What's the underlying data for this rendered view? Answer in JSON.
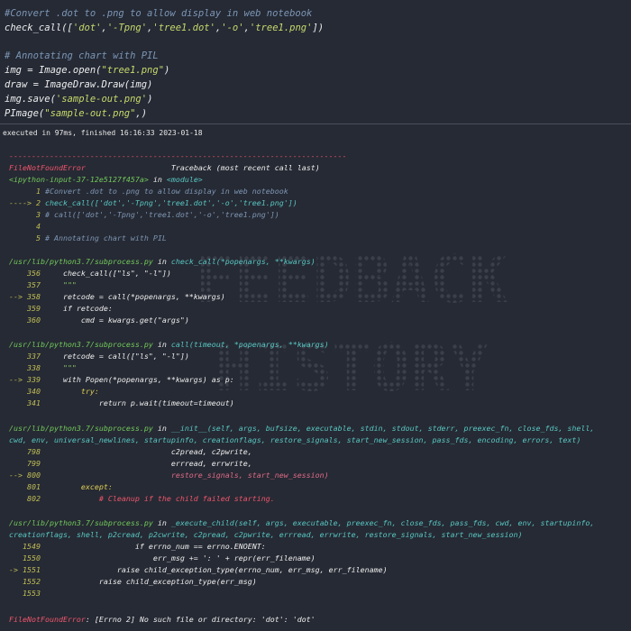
{
  "code_cell": {
    "comment1": "#Convert .dot to .png to allow display in web notebook",
    "call_line": {
      "fn": "check_call",
      "open": "([",
      "args": [
        "'dot'",
        "'-Tpng'",
        "'tree1.dot'",
        "'-o'",
        "'tree1.png'"
      ],
      "close": "])",
      "sep": ","
    },
    "comment2": "# Annotating chart with PIL",
    "img_line": {
      "var": "img",
      "op": " = ",
      "call": "Image.open(",
      "str": "\"tree1.png\"",
      "end": ")"
    },
    "draw_line": {
      "var": "draw",
      "op": " = ",
      "call": "ImageDraw.Draw(img)"
    },
    "save_line": {
      "call": "img.save(",
      "str": "'sample-out.png'",
      "end": ")"
    },
    "pimage_line": {
      "call": "PImage(",
      "str": "\"sample-out.png\"",
      "end": ",)"
    }
  },
  "status": "executed in 97ms, finished 16:16:33 2023-01-18",
  "traceback": {
    "dashes": "---------------------------------------------------------------------------",
    "error_name": "FileNotFoundError",
    "header_right": "Traceback (most recent call last)",
    "ipy_input": "<ipython-input-37-12e5127f457a>",
    "in_word": " in ",
    "module": "<module>",
    "frame1": [
      {
        "num": "      1",
        "body": " #Convert .dot to .png to allow display in web notebook",
        "cls": "c-comment"
      },
      {
        "num": "----> 2",
        "body": " check_call(['dot','-Tpng','tree1.dot','-o','tree1.png'])",
        "cls": "c-teal"
      },
      {
        "num": "      3",
        "body": " # call(['dot','-Tpng','tree1.dot','-o','tree1.png'])",
        "cls": "c-comment"
      },
      {
        "num": "      4",
        "body": "",
        "cls": "c-white"
      },
      {
        "num": "      5",
        "body": " # Annotating chart with PIL",
        "cls": "c-comment"
      }
    ],
    "sections": [
      {
        "file": "/usr/lib/python3.7/subprocess.py",
        "fn": "check_call",
        "sig": "(*popenargs, **kwargs)",
        "sig2": "",
        "lines": [
          {
            "num": "    356",
            "body": "     check_call([\"ls\", \"-l\"])",
            "cls": "c-white"
          },
          {
            "num": "    357",
            "body": "     \"\"\"",
            "cls": "c-strg"
          },
          {
            "num": "--> 358",
            "body": "     retcode = call(*popenargs, **kwargs)",
            "cls": "c-white"
          },
          {
            "num": "    359",
            "body": "     if retcode:",
            "cls": "c-white"
          },
          {
            "num": "    360",
            "body": "         cmd = kwargs.get(\"args\")",
            "cls": "c-white"
          }
        ]
      },
      {
        "file": "/usr/lib/python3.7/subprocess.py",
        "fn": "call",
        "sig": "(timeout, *popenargs, **kwargs)",
        "sig2": "",
        "lines": [
          {
            "num": "    337",
            "body": "     retcode = call([\"ls\", \"-l\"])",
            "cls": "c-white"
          },
          {
            "num": "    338",
            "body": "     \"\"\"",
            "cls": "c-strg"
          },
          {
            "num": "--> 339",
            "body": "     with Popen(*popenargs, **kwargs) as p:",
            "cls": "c-white"
          },
          {
            "num": "    340",
            "body": "         try:",
            "cls": "c-yellow"
          },
          {
            "num": "    341",
            "body": "             return p.wait(timeout=timeout)",
            "cls": "c-white"
          }
        ]
      },
      {
        "file": "/usr/lib/python3.7/subprocess.py",
        "fn": "__init__",
        "sig": "(self, args, bufsize, executable, stdin, stdout, stderr, preexec_fn, close_fds, shell,",
        "sig2": "cwd, env, universal_newlines, startupinfo, creationflags, restore_signals, start_new_session, pass_fds, encoding, errors, text)",
        "lines": [
          {
            "num": "    798",
            "body": "                             c2pread, c2pwrite,",
            "cls": "c-white"
          },
          {
            "num": "    799",
            "body": "                             errread, errwrite,",
            "cls": "c-white"
          },
          {
            "num": "--> 800",
            "body": "                             restore_signals, start_new_session)",
            "cls": "c-pink"
          },
          {
            "num": "    801",
            "body": "         except:",
            "cls": "c-yellow"
          },
          {
            "num": "    802",
            "body": "             # Cleanup if the child failed starting.",
            "cls": "c-red"
          }
        ]
      },
      {
        "file": "/usr/lib/python3.7/subprocess.py",
        "fn": "_execute_child",
        "sig": "(self, args, executable, preexec_fn, close_fds, pass_fds, cwd, env, startupinfo,",
        "sig2": "creationflags, shell, p2cread, p2cwrite, c2pread, c2pwrite, errread, errwrite, restore_signals, start_new_session)",
        "lines": [
          {
            "num": "   1549",
            "body": "                     if errno_num == errno.ENOENT:",
            "cls": "c-white"
          },
          {
            "num": "   1550",
            "body": "                         err_msg += ': ' + repr(err_filename)",
            "cls": "c-white"
          },
          {
            "num": "-> 1551",
            "body": "                 raise child_exception_type(errno_num, err_msg, err_filename)",
            "cls": "c-white"
          },
          {
            "num": "   1552",
            "body": "             raise child_exception_type(err_msg)",
            "cls": "c-white"
          },
          {
            "num": "   1553",
            "body": "",
            "cls": "c-white"
          }
        ]
      }
    ],
    "final_error": "FileNotFoundError",
    "final_msg": ": [Errno 2] No such file or directory: 'dot': 'dot'"
  },
  "watermark": {
    "line1": "FEEDBACK",
    "line2": "HISTORY"
  },
  "colors": {
    "background": "#262a34",
    "comment": "#7d96b4",
    "error": "#f0556c",
    "path": "#72c95b"
  }
}
